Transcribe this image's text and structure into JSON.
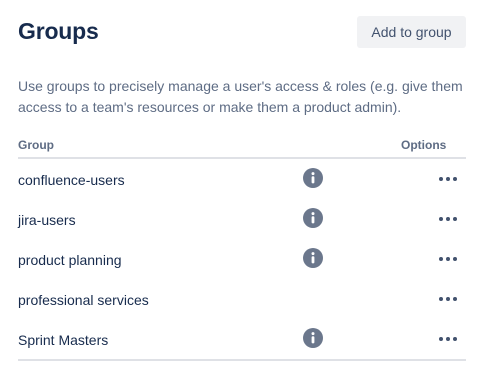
{
  "header": {
    "title": "Groups",
    "add_button_label": "Add to group"
  },
  "description": "Use groups to precisely manage a user's access & roles (e.g. give them access to a team's resources or make them a product admin).",
  "table": {
    "columns": [
      "Group",
      "Options"
    ],
    "rows": [
      {
        "name": "confluence-users",
        "has_info": true,
        "options_icon": "more-horizontal-icon"
      },
      {
        "name": "jira-users",
        "has_info": true,
        "options_icon": "more-horizontal-icon"
      },
      {
        "name": "product planning",
        "has_info": true,
        "options_icon": "more-horizontal-icon"
      },
      {
        "name": "professional services",
        "has_info": false,
        "options_icon": "more-horizontal-icon"
      },
      {
        "name": "Sprint Masters",
        "has_info": true,
        "options_icon": "more-horizontal-icon"
      }
    ]
  },
  "colors": {
    "heading": "#172b4d",
    "muted_text": "#5e6c84",
    "info_icon_bg": "#6b778c",
    "button_bg": "#f1f2f4",
    "divider": "#dfe1e6"
  }
}
